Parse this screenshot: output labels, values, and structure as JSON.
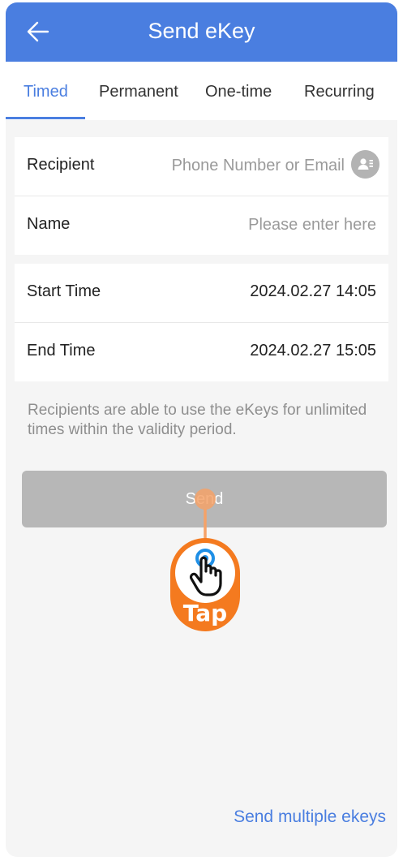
{
  "header": {
    "title": "Send eKey"
  },
  "tabs": [
    {
      "label": "Timed",
      "active": true
    },
    {
      "label": "Permanent",
      "active": false
    },
    {
      "label": "One-time",
      "active": false
    },
    {
      "label": "Recurring",
      "active": false
    }
  ],
  "form": {
    "recipient": {
      "label": "Recipient",
      "placeholder": "Phone Number or Email",
      "value": ""
    },
    "name": {
      "label": "Name",
      "placeholder": "Please enter here",
      "value": ""
    }
  },
  "validity": {
    "start": {
      "label": "Start Time",
      "value": "2024.02.27 14:05"
    },
    "end": {
      "label": "End Time",
      "value": "2024.02.27 15:05"
    }
  },
  "hint": "Recipients are able to use the eKeys for unlimited times within the validity period.",
  "send_button": {
    "label": "Send",
    "enabled": false
  },
  "tap_indicator": {
    "label": "Tap"
  },
  "footer_link": "Send multiple ekeys",
  "colors": {
    "brand_blue": "#4a7ee0",
    "disabled_button": "#b7b7b7",
    "tap_orange": "#f47a1f",
    "background": "#f5f5f5"
  },
  "icons": {
    "back": "arrow-left-icon",
    "contact": "contact-book-icon",
    "tap": "hand-pointer-icon"
  }
}
